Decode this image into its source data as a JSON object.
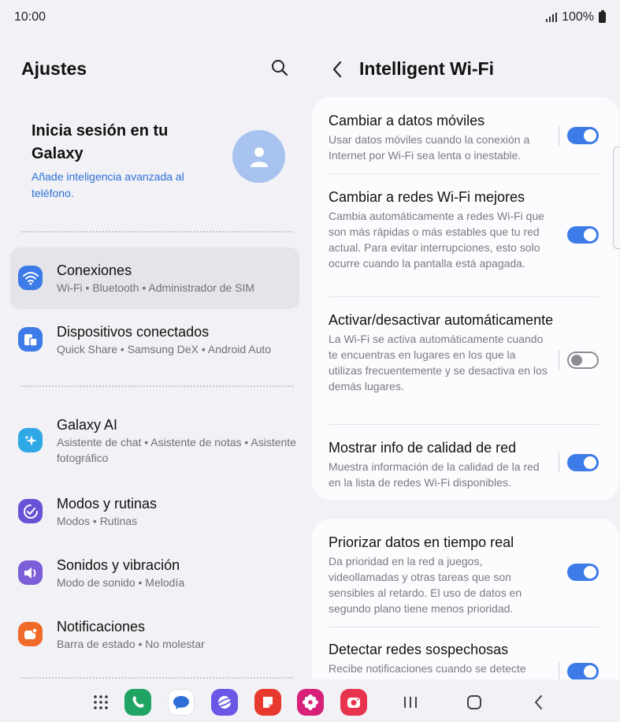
{
  "status": {
    "time": "10:00",
    "battery": "100%"
  },
  "left": {
    "title": "Ajustes",
    "signin": {
      "title": "Inicia sesión en tu Galaxy",
      "subtitle": "Añade inteligencia avanzada al teléfono."
    },
    "items": [
      {
        "title": "Conexiones",
        "subtitle": "Wi-Fi  •  Bluetooth  •  Administrador de SIM",
        "icon": "wifi-icon",
        "color": "#3d7be8"
      },
      {
        "title": "Dispositivos conectados",
        "subtitle": "Quick Share  •  Samsung DeX  •  Android Auto",
        "icon": "devices-icon",
        "color": "#3d7be8"
      },
      {
        "title": "Galaxy AI",
        "subtitle": "Asistente de chat  •  Asistente de notas  •  Asistente fotográfico",
        "icon": "sparkle-icon",
        "color": "#2fa8e6"
      },
      {
        "title": "Modos y rutinas",
        "subtitle": "Modos  •  Rutinas",
        "icon": "check-circle-icon",
        "color": "#6a52d6"
      },
      {
        "title": "Sonidos y vibración",
        "subtitle": "Modo de sonido  •  Melodía",
        "icon": "speaker-icon",
        "color": "#7b5fd9"
      },
      {
        "title": "Notificaciones",
        "subtitle": "Barra de estado  •  No molestar",
        "icon": "notification-icon",
        "color": "#f06a2a"
      }
    ]
  },
  "right": {
    "title": "Intelligent Wi-Fi",
    "settings": [
      {
        "title": "Cambiar a datos móviles",
        "desc": "Usar datos móviles cuando la conexión a Internet por Wi-Fi sea lenta o inestable.",
        "on": true
      },
      {
        "title": "Cambiar a redes Wi-Fi mejores",
        "desc": "Cambia automáticamente a redes Wi-Fi que son más rápidas o más estables que tu red actual. Para evitar interrupciones, esto solo ocurre cuando la pantalla está apagada.",
        "on": true
      },
      {
        "title": "Activar/desactivar automáticamente",
        "desc": "La Wi-Fi se activa automáticamente cuando te encuentras en lugares en los que la utilizas frecuentemente y se desactiva en los demás lugares.",
        "on": false
      },
      {
        "title": "Mostrar info de calidad de red",
        "desc": "Muestra información de la calidad de la red en la lista de redes Wi-Fi disponibles.",
        "on": true
      },
      {
        "title": "Priorizar datos en tiempo real",
        "desc": "Da prioridad en la red a juegos, videollamadas y otras tareas que son sensibles al retardo. El uso de datos en segundo plano tiene menos prioridad.",
        "on": true
      },
      {
        "title": "Detectar redes sospechosas",
        "desc": "Recibe notificaciones cuando se detecte",
        "on": true
      }
    ]
  },
  "dock": {
    "apps": [
      {
        "name": "phone-app-icon",
        "color": "#1fa463"
      },
      {
        "name": "messages-app-icon",
        "color": "#ffffff"
      },
      {
        "name": "internet-app-icon",
        "color": "#6a57e6"
      },
      {
        "name": "notes-app-icon",
        "color": "#e8392f"
      },
      {
        "name": "gallery-app-icon",
        "color": "#d6207a"
      },
      {
        "name": "camera-app-icon",
        "color": "#e8334f"
      }
    ]
  }
}
